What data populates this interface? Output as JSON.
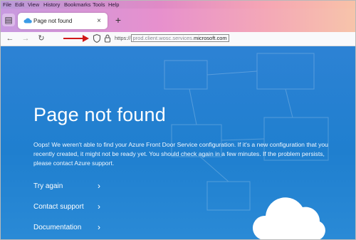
{
  "menu": [
    "File",
    "Edit",
    "View",
    "History",
    "Bookmarks",
    "Tools",
    "Help"
  ],
  "tab": {
    "title": "Page not found",
    "close": "×"
  },
  "new_tab": "+",
  "url": {
    "scheme": "https://",
    "host": "prod.client.wosc.services.",
    "domain": "microsoft.com"
  },
  "page": {
    "heading": "Page not found",
    "description": "Oops! We weren't able to find your Azure Front Door Service configuration. If it's a new configuration that you recently created, it might not be ready yet. You should check again in a few minutes. If the problem persists, please contact Azure support.",
    "links": [
      "Try again",
      "Contact support",
      "Documentation"
    ]
  },
  "colors": {
    "page_bg": "#1f7fcf",
    "annotation_arrow": "#d01818"
  }
}
